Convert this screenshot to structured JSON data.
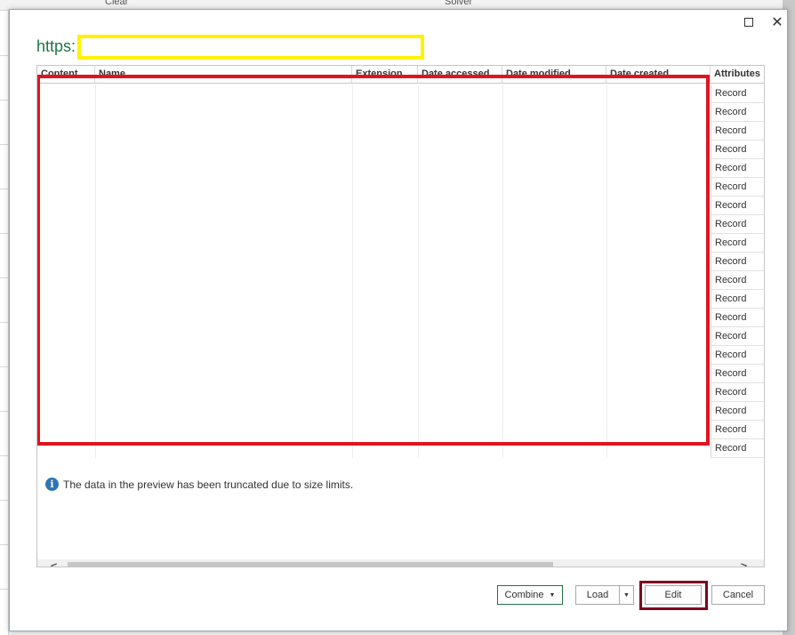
{
  "background": {
    "ribbon_fragments": [
      "Clear",
      "Solver"
    ]
  },
  "dialog": {
    "url_prefix": "https:",
    "columns": [
      "Content",
      "Name",
      "Extension",
      "Date accessed",
      "Date modified",
      "Date created",
      "Attributes"
    ],
    "attribute_values": [
      "Record",
      "Record",
      "Record",
      "Record",
      "Record",
      "Record",
      "Record",
      "Record",
      "Record",
      "Record",
      "Record",
      "Record",
      "Record",
      "Record",
      "Record",
      "Record",
      "Record",
      "Record",
      "Record",
      "Record"
    ],
    "truncation_notice": "The data in the preview has been truncated due to size limits.",
    "buttons": {
      "combine": "Combine",
      "load": "Load",
      "edit": "Edit",
      "cancel": "Cancel"
    },
    "highlight_colors": {
      "url_box": "#fff200",
      "table_box": "#e0141e",
      "edit_box": "#800020"
    }
  }
}
